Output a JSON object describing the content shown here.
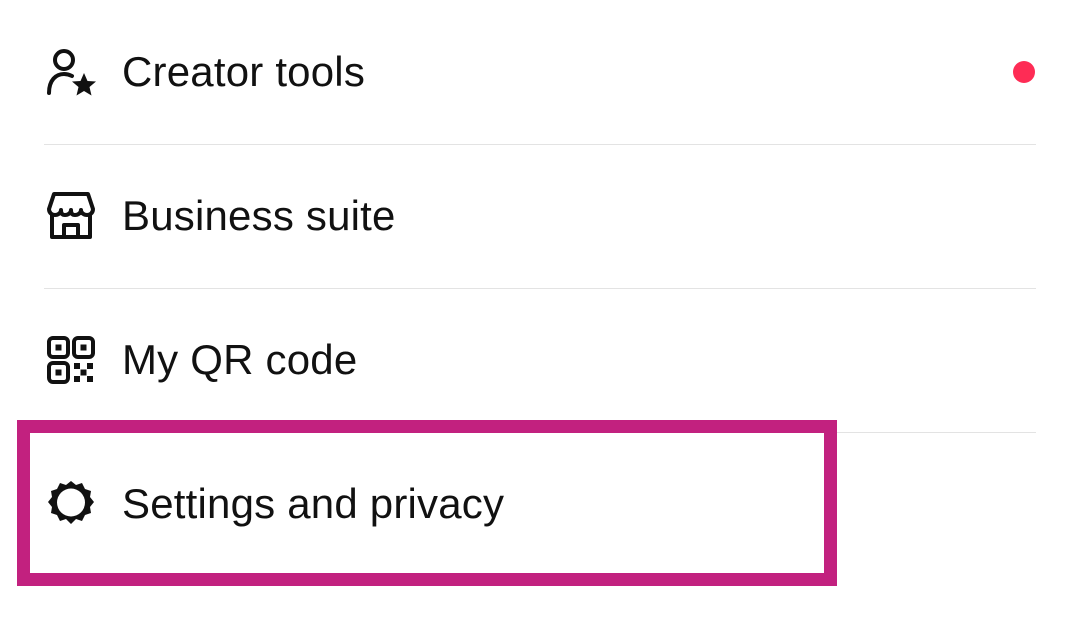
{
  "menu": {
    "items": [
      {
        "id": "creator-tools",
        "label": "Creator tools",
        "icon": "person-star-icon",
        "has_notification_dot": true
      },
      {
        "id": "business-suite",
        "label": "Business suite",
        "icon": "storefront-icon",
        "has_notification_dot": false
      },
      {
        "id": "my-qr-code",
        "label": "My QR code",
        "icon": "qr-code-icon",
        "has_notification_dot": false
      },
      {
        "id": "settings-and-privacy",
        "label": "Settings and privacy",
        "icon": "gear-icon",
        "has_notification_dot": false
      }
    ]
  },
  "highlight": {
    "target": "settings-and-privacy",
    "color": "#c2217f"
  },
  "colors": {
    "notification_dot": "#fe2c55",
    "text": "#111111",
    "divider": "#e3e3e3",
    "background": "#ffffff"
  }
}
